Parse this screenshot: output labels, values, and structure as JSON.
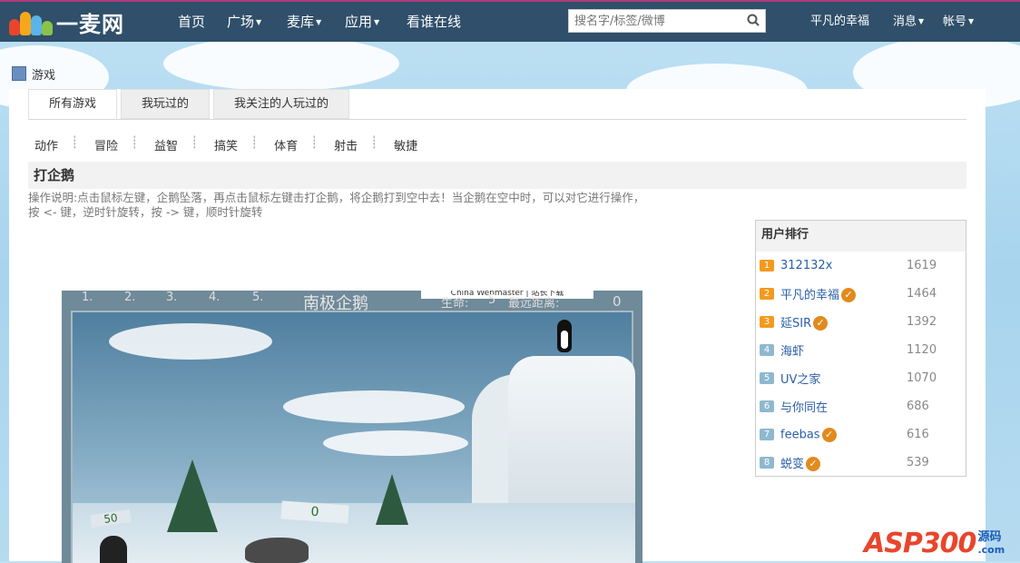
{
  "header": {
    "logo_text": "一麦网",
    "nav": [
      {
        "label": "首页",
        "dropdown": false
      },
      {
        "label": "广场",
        "dropdown": true
      },
      {
        "label": "麦库",
        "dropdown": true
      },
      {
        "label": "应用",
        "dropdown": true
      },
      {
        "label": "看谁在线",
        "dropdown": false
      }
    ],
    "search_placeholder": "搜名字/标签/微博",
    "user_name": "平凡的幸福",
    "messages_label": "消息",
    "account_label": "帐号"
  },
  "breadcrumb": {
    "label": "游戏"
  },
  "tabs": [
    "所有游戏",
    "我玩过的",
    "我关注的人玩过的"
  ],
  "categories": [
    "动作",
    "冒险",
    "益智",
    "搞笑",
    "体育",
    "射击",
    "敏捷"
  ],
  "game": {
    "title": "打企鹅",
    "description": "操作说明:点击鼠标左键，企鹅坠落，再点击鼠标左键击打企鹅，将企鹅打到空中去！当企鹅在空中时，可以对它进行操作，按 <- 键，逆时针旋转，按 -> 键，顺时针旋转",
    "hud_slots": [
      "1.",
      "2.",
      "3.",
      "4.",
      "5."
    ],
    "hud_title": "南极企鹅",
    "hud_life": "生命:",
    "hud_life_value": "5",
    "hud_distance": "最远距离:",
    "hud_score": "0",
    "hud_banner": "China Webmaster | 站长下载",
    "sign_left": "50",
    "sign_mid": "0"
  },
  "ranking": {
    "title": "用户排行",
    "items": [
      {
        "rank": "1",
        "name": "312132x",
        "value": "1619",
        "verified": false
      },
      {
        "rank": "2",
        "name": "平凡的幸福",
        "value": "1464",
        "verified": true
      },
      {
        "rank": "3",
        "name": "延SIR",
        "value": "1392",
        "verified": true
      },
      {
        "rank": "4",
        "name": "海虾",
        "value": "1120",
        "verified": false
      },
      {
        "rank": "5",
        "name": "UV之家",
        "value": "1070",
        "verified": false
      },
      {
        "rank": "6",
        "name": "与你同在",
        "value": "686",
        "verified": false
      },
      {
        "rank": "7",
        "name": "feebas",
        "value": "616",
        "verified": true
      },
      {
        "rank": "8",
        "name": "蜕变",
        "value": "539",
        "verified": true
      }
    ]
  },
  "watermark": {
    "text": "ASP300",
    "sub": "源码",
    "domain": ".com"
  },
  "colors": {
    "topbar": "#2f4f6a",
    "accent": "#e08b1e",
    "link": "#2a5ea8"
  }
}
